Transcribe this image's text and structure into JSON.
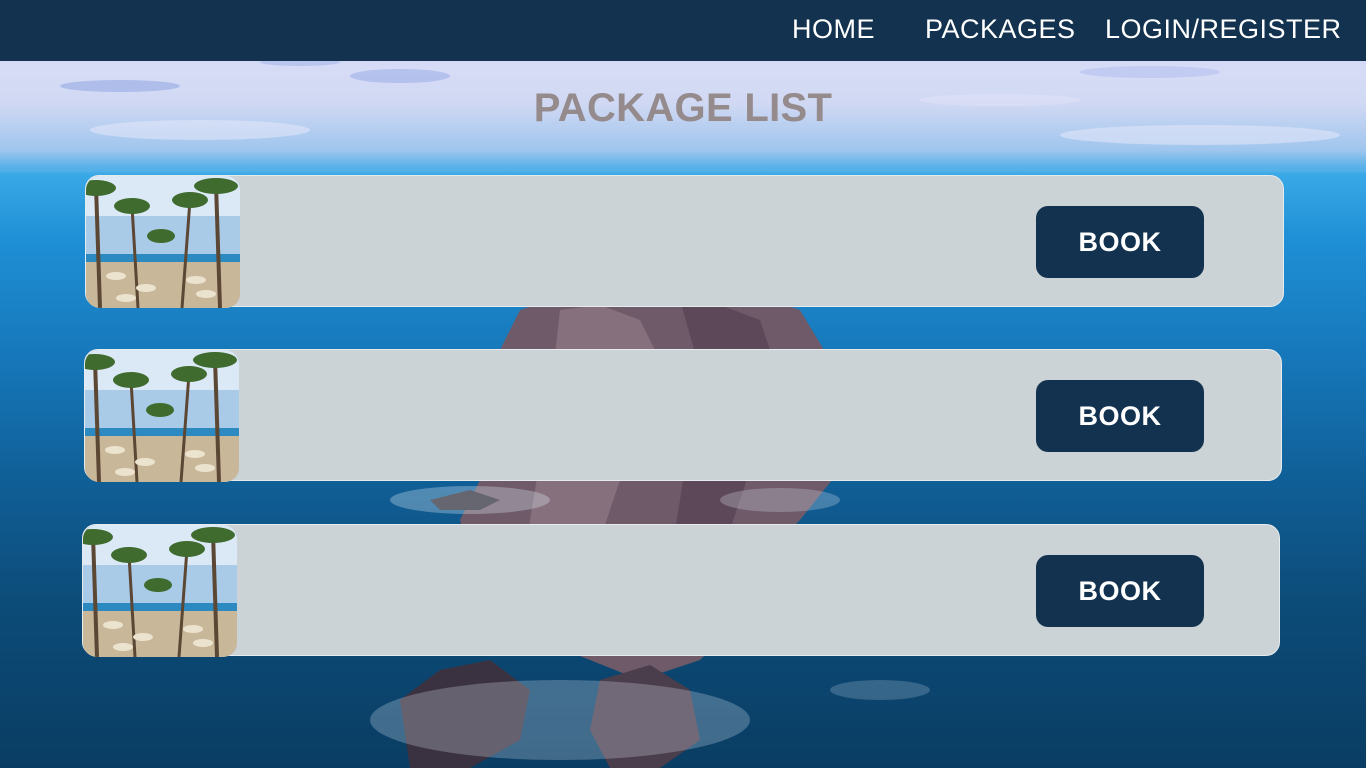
{
  "nav": {
    "home": "HOME",
    "packages": "PACKAGES",
    "login": "LOGIN/REGISTER"
  },
  "page": {
    "title": "PACKAGE LIST"
  },
  "packages": [
    {
      "button_label": "BOOK",
      "image": "beach-palm-trees-photo"
    },
    {
      "button_label": "BOOK",
      "image": "beach-palm-trees-photo"
    },
    {
      "button_label": "BOOK",
      "image": "beach-palm-trees-photo"
    }
  ],
  "colors": {
    "navbar": "#12324f",
    "card": "#cbd3d6",
    "button": "#12324f",
    "title": "#958a8c"
  }
}
